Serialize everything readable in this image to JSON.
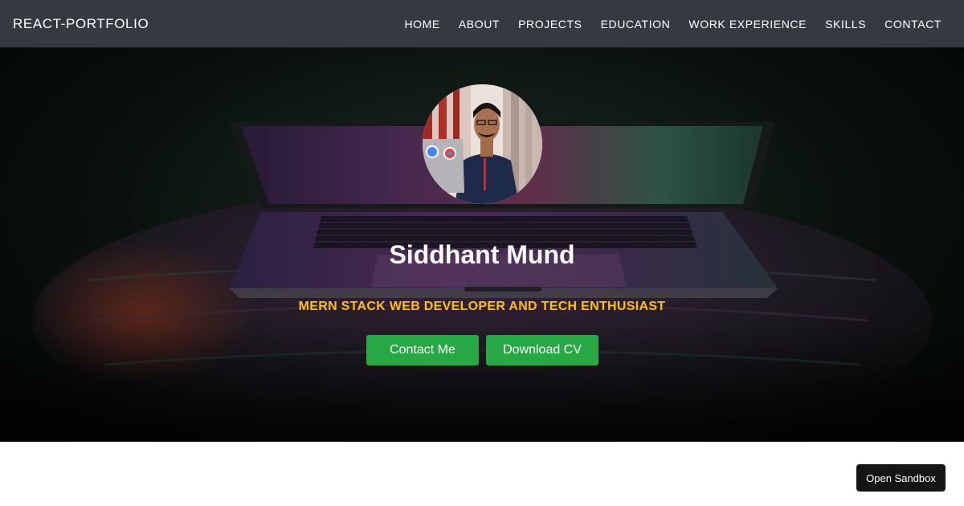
{
  "navbar": {
    "brand": "REACT-PORTFOLIO",
    "links": [
      "HOME",
      "ABOUT",
      "PROJECTS",
      "EDUCATION",
      "WORK EXPERIENCE",
      "SKILLS",
      "CONTACT"
    ]
  },
  "hero": {
    "name": "Siddhant Mund",
    "tagline": "MERN STACK WEB DEVELOPER AND TECH ENTHUSIAST",
    "contact_button": "Contact Me",
    "cv_button": "Download CV"
  },
  "sandbox": {
    "label": "Open Sandbox"
  },
  "colors": {
    "navbar": "#343a40",
    "accent_green": "#28a745",
    "tagline_yellow": "#ffc107"
  }
}
